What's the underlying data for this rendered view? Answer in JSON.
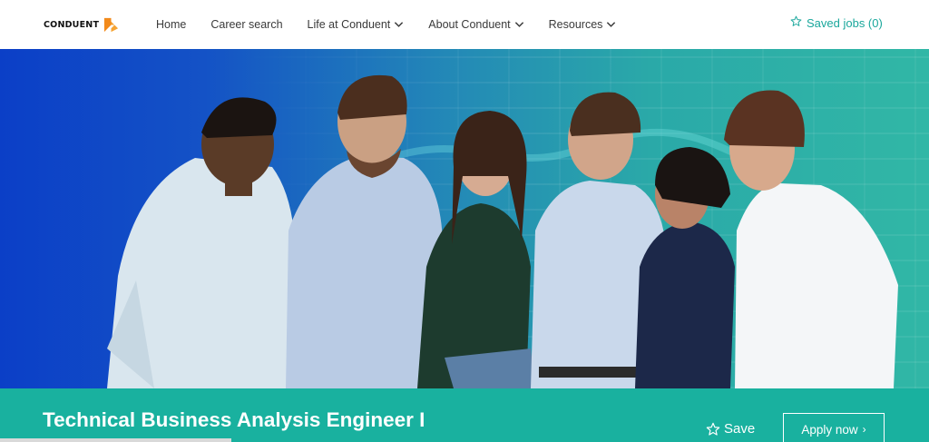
{
  "header": {
    "logo_text": "CONDUENT",
    "nav": [
      {
        "label": "Home",
        "has_dropdown": false
      },
      {
        "label": "Career search",
        "has_dropdown": false
      },
      {
        "label": "Life at Conduent",
        "has_dropdown": true
      },
      {
        "label": "About Conduent",
        "has_dropdown": true
      },
      {
        "label": "Resources",
        "has_dropdown": true
      }
    ],
    "saved_jobs_label": "Saved jobs (0)",
    "saved_jobs_icon": "star-outline-icon"
  },
  "hero": {
    "image": "group-of-smiling-colleagues-photo"
  },
  "job": {
    "title": "Technical Business Analysis Engineer I",
    "save_label": "Save",
    "apply_label": "Apply now",
    "apply_arrow": "›"
  },
  "colors": {
    "accent": "#1aa79c",
    "jobbar": "#19b19f",
    "logo_orange": "#f28a1b",
    "hero_blue": "#0b3fc7"
  }
}
